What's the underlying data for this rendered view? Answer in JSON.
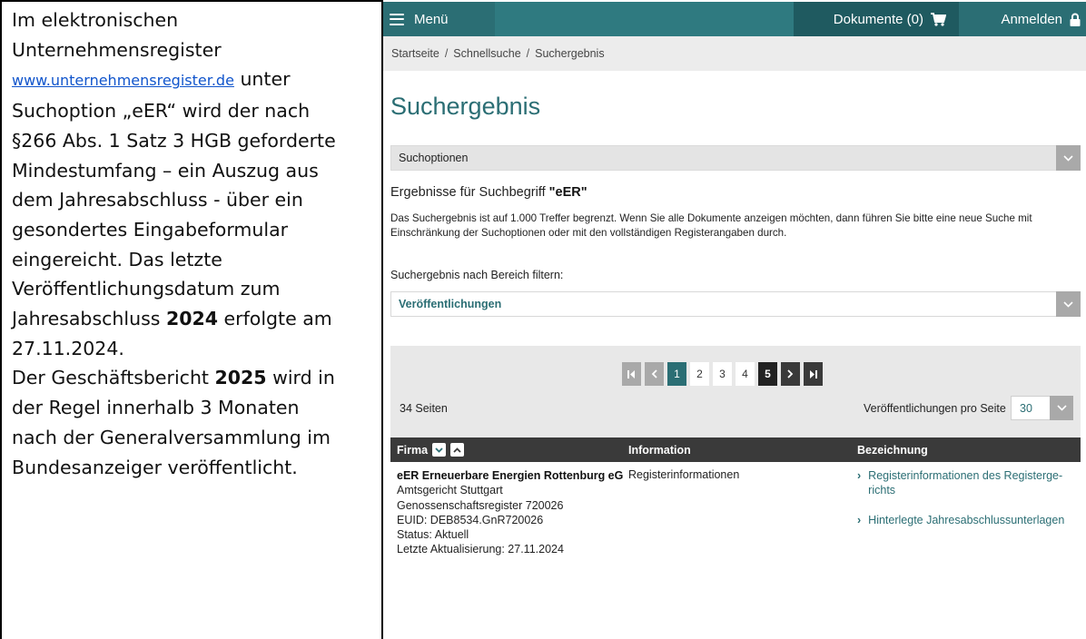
{
  "left_text": {
    "line1": "Im elektronischen",
    "line2": "Unternehmensregister",
    "link": "www.unternehmensregister.de",
    "line3_after_link": " unter",
    "line4": "Suchoption „eER“ wird der nach",
    "line5": "§266 Abs. 1 Satz 3 HGB geforderte",
    "line6": "Mindestumfang – ein Auszug aus",
    "line7": "dem Jahresabschluss - über ein",
    "line8": "gesondertes Eingabeformular",
    "line9": "eingereicht. Das letzte",
    "line10": "Veröffentlichungsdatum zum",
    "line11_pre": "Jahresabschluss ",
    "line11_bold": "2024",
    "line11_post": " erfolgte am",
    "line12": "27.11.2024.",
    "line13_pre": "Der Geschäftsbericht ",
    "line13_bold": "2025",
    "line13_post": " wird in",
    "line14": "der Regel innerhalb 3 Monaten",
    "line15": "nach der Generalversammlung im",
    "line16": "Bundesanzeiger veröffentlicht."
  },
  "topbar": {
    "menu_label": "Menü",
    "docs_label": "Dokumente (0)",
    "login_label": "Anmelden"
  },
  "breadcrumb": {
    "items": [
      "Startseite",
      "Schnellsuche",
      "Suchergebnis"
    ],
    "separator": "/"
  },
  "page": {
    "title": "Suchergebnis",
    "search_options_label": "Suchoptionen",
    "results_prefix": "Ergebnisse für Suchbegriff ",
    "results_term": "\"eER\"",
    "results_desc": "Das Suchergebnis ist auf 1.000 Treffer begrenzt. Wenn Sie alle Dokumente anzeigen möchten, dann führen Sie bitte eine neue Suche mit Einschränkung der Suchoptionen oder mit den vollständigen Registerangaben durch.",
    "filter_label": "Suchergebnis nach Bereich filtern:",
    "filter_selected": "Veröffentlichungen"
  },
  "pager": {
    "pages": [
      "1",
      "2",
      "3",
      "4",
      "5"
    ],
    "current": "1",
    "highlighted": "5",
    "pages_count": "34 Seiten",
    "per_page_label": "Veröffentlichungen pro Seite",
    "per_page_value": "30"
  },
  "table": {
    "headers": {
      "firma": "Firma",
      "information": "Information",
      "bezeichnung": "Bezeichnung"
    },
    "row": {
      "firma_name": "eER Erneuerbare Energien Rottenburg eG",
      "firma_lines": [
        "Amtsgericht Stuttgart",
        "Genossenschaftsregister 720026",
        "EUID: DEB8534.GnR720026",
        "Status: Aktuell",
        "Letzte Aktualisierung: 27.11.2024"
      ],
      "information": "Registerinformationen",
      "bez_link1_line1": "Registerinformationen des Registerge-",
      "bez_link1_line2": "richts",
      "bez_link2": "Hinterlegte Jahresabschlussunterlagen"
    }
  },
  "colors": {
    "teal": "#2b6e74",
    "dark": "#3a3a3a",
    "grey_bg": "#e8e8e8"
  }
}
